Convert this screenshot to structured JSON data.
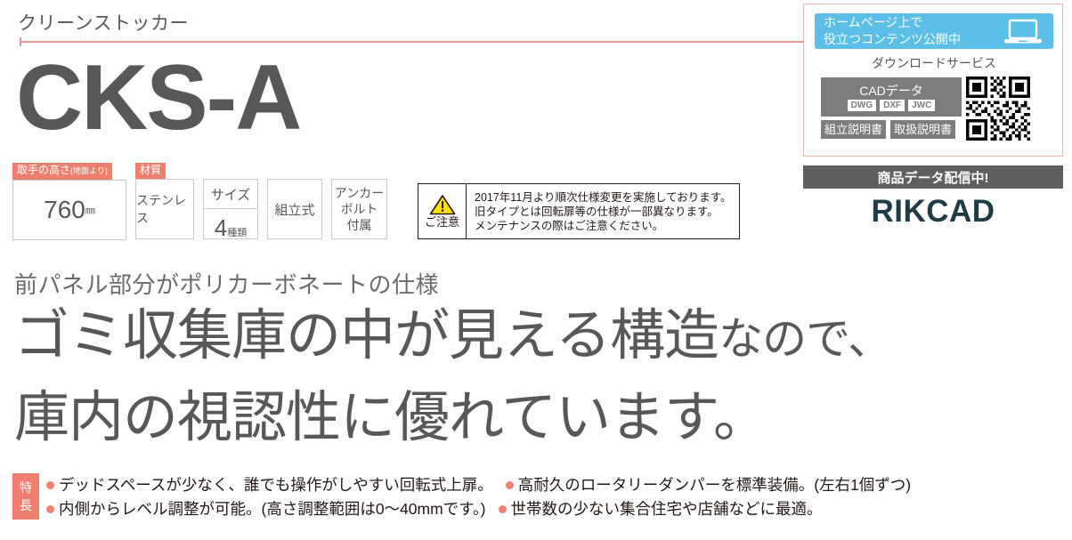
{
  "header": {
    "series_name": "クリーンストッカー",
    "model_name": "CKS-A"
  },
  "specs": [
    {
      "tag": "取手の高さ",
      "tag_small": "(地面より)",
      "value": "760",
      "unit": "㎜",
      "kind": "value-unit"
    },
    {
      "tag": "材質",
      "value": "ステンレス",
      "kind": "text"
    },
    {
      "tag": "",
      "top": "サイズ",
      "value": "4",
      "unit": "種類",
      "kind": "split"
    },
    {
      "tag": "",
      "value": "組立式",
      "kind": "text"
    },
    {
      "tag": "",
      "value_line1": "アンカー",
      "value_line2": "ボルト",
      "value_line3": "付属",
      "kind": "multiline"
    }
  ],
  "caution": {
    "icon_name": "warning-triangle-icon",
    "label": "ご注意",
    "lines": [
      "2017年11月より順次仕様変更を実施しております。",
      "旧タイプとは回転扉等の仕様が一部異なります。",
      "メンテナンスの際はご注意ください。"
    ]
  },
  "download_panel": {
    "banner_line1": "ホームページ上で",
    "banner_line2": "役立つコンテンツ公開中",
    "banner_icon": "laptop-icon",
    "title": "ダウンロードサービス",
    "cad_title": "CADデータ",
    "cad_formats": [
      "DWG",
      "DXF",
      "JWC"
    ],
    "doc_buttons": [
      "組立説明書",
      "取扱説明書"
    ],
    "qr_name": "qr-code"
  },
  "rikcad": {
    "bar_label": "商品データ配信中!",
    "logo": "RIKCAD"
  },
  "hero": {
    "lead": "前パネル部分がポリカーボネートの仕様",
    "line1_big": "ゴミ収集庫の中が見える構造",
    "line1_small": "なので、",
    "line2": "庫内の視認性に優れています。"
  },
  "features": {
    "badge_line1": "特",
    "badge_line2": "長",
    "rows": [
      [
        "デッドスペースが少なく、誰でも操作がしやすい回転式上扉。",
        "高耐久のロータリーダンパーを標準装備。(左右1個ずつ)"
      ],
      [
        "内側からレベル調整が可能。(高さ調整範囲は0〜40mmです。)",
        "世帯数の少ない集合住宅や店舗などに最適。"
      ]
    ]
  },
  "colors": {
    "accent_coral": "#ee7f6e",
    "rule_coral": "#e79a8e",
    "banner_blue": "#5bbfe8",
    "gray_button": "#7d7d7d",
    "dark_bar": "#5f5f5f",
    "rikcad_navy": "#1d3c44",
    "text_gray": "#595757"
  }
}
